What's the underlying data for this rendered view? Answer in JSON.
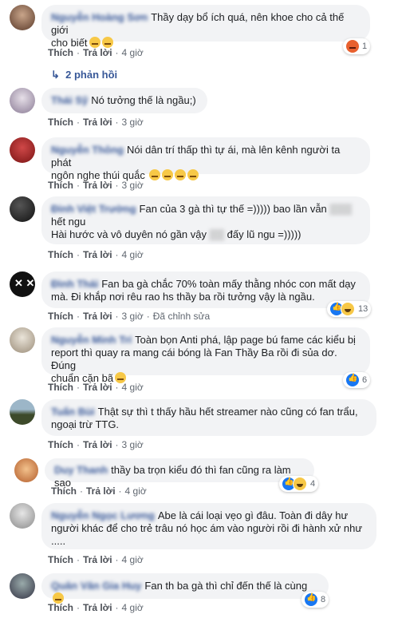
{
  "comments": [
    {
      "name": "Nguyễn Hoàng Sơn",
      "text1": "Thầy dạy bổ ích quá, nên khoe cho cả thế giới",
      "text2": "cho biết",
      "like": "Thích",
      "reply": "Trả lời",
      "time": "4 giờ",
      "count": "1"
    },
    {
      "name": "Thái Sỹ",
      "text1": "Nó tưởng thế là ngầu;)",
      "like": "Thích",
      "reply": "Trả lời",
      "time": "3 giờ"
    },
    {
      "name": "Nguyễn Thông",
      "text1": "Nói dân trí thấp thì tự ái, mà lên kênh người ta phát",
      "text2": "ngôn nghe thúi quắc",
      "like": "Thích",
      "reply": "Trả lời",
      "time": "3 giờ"
    },
    {
      "name": "Đinh Việt Trường",
      "text1": "Fan của 3 gà thì tự thế =))))) bao lần vẫn",
      "text2": "hết ngu",
      "text3": "Hài hước và vô duyên nó gần vậy",
      "text3b": "đấy lũ ngu =)))))",
      "like": "Thích",
      "reply": "Trả lời",
      "time": "4 giờ"
    },
    {
      "name": "Đình Thái",
      "text1": "Fan ba gà chắc 70% toàn mấy thằng nhóc con mất dạy",
      "text2": "mà. Đi khắp nơi rêu rao hs thầy ba rồi tưởng vậy là ngầu.",
      "like": "Thích",
      "reply": "Trả lời",
      "time": "3 giờ",
      "edited": "Đã chỉnh sửa",
      "count": "13"
    },
    {
      "name": "Nguyễn Minh Trí",
      "text1": "Toàn bọn Anti phá, lập page bú fame các kiểu bị",
      "text2": "report thì quay ra mang cái bóng là Fan Thầy Ba rồi đi sủa dơ. Đúng",
      "text3": "chuẩn cặn bã",
      "like": "Thích",
      "reply": "Trả lời",
      "time": "4 giờ",
      "count": "6"
    },
    {
      "name": "Tuấn Bùi",
      "text1": "Thật sự thì t thấy hầu hết streamer nào cũng có fan trẩu,",
      "text2": "ngoại trừ TTG.",
      "like": "Thích",
      "reply": "Trả lời",
      "time": "3 giờ"
    },
    {
      "name": "Duy Thanh",
      "text1": "thầy ba trọn kiểu đó thì fan cũng ra làm sao",
      "like": "Thích",
      "reply": "Trả lời",
      "time": "4 giờ",
      "count": "4"
    },
    {
      "name": "Nguyễn Ngọc Lương",
      "text1": "Abe là cái loại vẹo gì đâu. Toàn đi dây hư",
      "text2": "người khác để cho trẻ trâu nó học ám vào người rồi đi hành xử như",
      "text3": ".....",
      "like": "Thích",
      "reply": "Trả lời",
      "time": "4 giờ"
    },
    {
      "name": "Quân Văn Gia Huy",
      "text1": "Fan th ba gà thì chỉ đến thế là cùng",
      "like": "Thích",
      "reply": "Trả lời",
      "time": "4 giờ",
      "count": "8"
    }
  ],
  "replies_link": "2 phản hồi"
}
